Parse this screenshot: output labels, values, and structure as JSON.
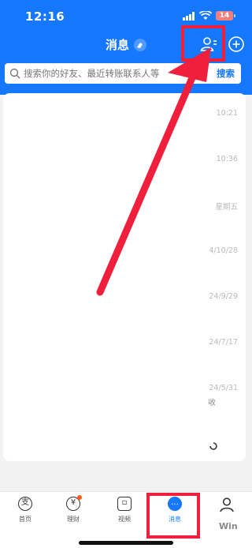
{
  "status_bar": {
    "time": "12:16",
    "battery_level": "14",
    "signal_icon": "signal-bars-icon",
    "wifi_icon": "wifi-icon"
  },
  "header": {
    "title": "消息",
    "title_icon": "broom-icon",
    "contacts_icon": "contacts-icon",
    "add_icon": "add-circle-icon"
  },
  "search": {
    "placeholder": "搜索你的好友、最近转账联系人等",
    "button_label": "搜索"
  },
  "messages": [
    {
      "time": "10:21"
    },
    {
      "time": "10:36"
    },
    {
      "time": "星期五"
    },
    {
      "time": "4/10/28"
    },
    {
      "time": "24/9/29"
    },
    {
      "time": "24/7/17"
    },
    {
      "time": "24/5/31",
      "fragment": "收"
    }
  ],
  "tabs": [
    {
      "label": "首页",
      "icon": "home-icon",
      "glyph": "支"
    },
    {
      "label": "理财",
      "icon": "wealth-icon",
      "glyph": "¥"
    },
    {
      "label": "视频",
      "icon": "video-icon",
      "glyph": "▫"
    },
    {
      "label": "消息",
      "icon": "message-icon",
      "glyph": "…"
    },
    {
      "label": "",
      "icon": "profile-icon",
      "glyph": ""
    }
  ],
  "colors": {
    "brand_blue": "#1677ff",
    "annotation_red": "#f0203c",
    "badge_orange": "#ff5a1f"
  },
  "watermark": "Win"
}
